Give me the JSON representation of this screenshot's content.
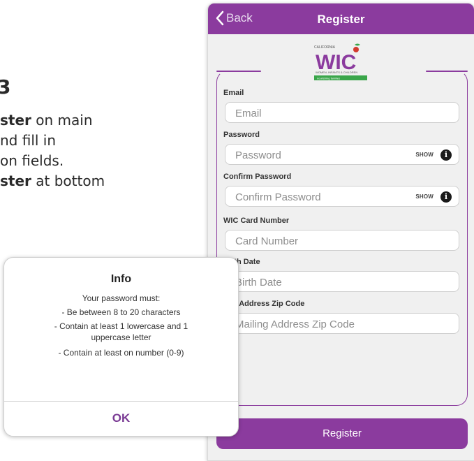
{
  "instructions": {
    "step_number": "3",
    "lines": [
      {
        "bold": "ster",
        "rest": " on main"
      },
      {
        "bold": "",
        "rest": "nd fill in"
      },
      {
        "bold": "",
        "rest": "on fields."
      },
      {
        "bold": "ster",
        "rest": " at bottom"
      }
    ]
  },
  "navbar": {
    "back_label": "Back",
    "title": "Register"
  },
  "logo": {
    "top_text": "CALIFORNIA",
    "brand": "WIC",
    "tagline": "WOMEN, INFANTS & CHILDREN",
    "bar_text": "nourishing families"
  },
  "form": {
    "email": {
      "label": "Email",
      "placeholder": "Email"
    },
    "password": {
      "label": "Password",
      "placeholder": "Password",
      "show_label": "SHOW"
    },
    "confirm_password": {
      "label": "Confirm Password",
      "placeholder": "Confirm Password",
      "show_label": "SHOW"
    },
    "card_number": {
      "label": "WIC Card Number",
      "placeholder": "Card Number"
    },
    "birth_date": {
      "label": "Birth Date",
      "placeholder": "Birth Date"
    },
    "zip_code": {
      "label": "ling Address Zip Code",
      "placeholder": "Mailing Address Zip Code"
    },
    "register_label": "Register"
  },
  "alert": {
    "title": "Info",
    "lines": [
      "Your password must:",
      "- Be between 8 to 20 characters",
      "- Contain at least 1 lowercase and 1",
      "uppercase letter",
      "- Contain at least on number (0-9)"
    ],
    "ok_label": "OK"
  },
  "colors": {
    "brand_purple": "#8b3b9e",
    "logo_green": "#3aa64a",
    "logo_red": "#d33a2f"
  }
}
